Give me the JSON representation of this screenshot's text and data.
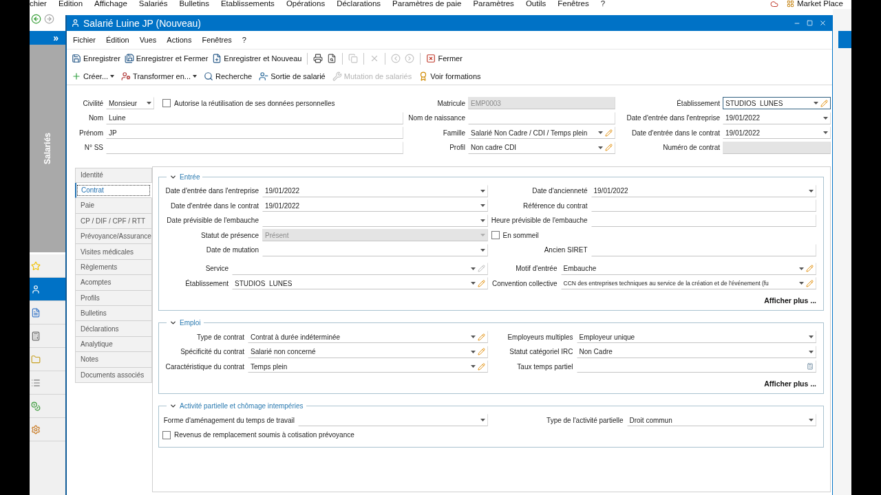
{
  "app_menu": [
    "chier",
    "Edition",
    "Affichage",
    "Salariés",
    "Bulletins",
    "Etablissements",
    "Opérations",
    "Déclarations",
    "Paramètres de paie",
    "Paramètres",
    "Outils",
    "Fenêtres",
    "?"
  ],
  "market_place": "Market Place",
  "side_panel": {
    "title": "Salariés",
    "expand": "»",
    "items": [
      {
        "selected": false
      },
      {
        "selected": true
      },
      {
        "selected": false
      },
      {
        "selected": false
      },
      {
        "selected": false
      },
      {
        "selected": false
      },
      {
        "selected": false
      },
      {
        "selected": false
      }
    ]
  },
  "window": {
    "title": "Salarié Luine JP (Nouveau)"
  },
  "menu": [
    "Fichier",
    "Édition",
    "Vues",
    "Actions",
    "Fenêtres",
    "?"
  ],
  "toolbar_1": [
    {
      "kind": "button",
      "label": "Enregistrer",
      "disabled": false
    },
    {
      "kind": "button",
      "label": "Enregistrer et Fermer",
      "disabled": false
    },
    {
      "kind": "button",
      "label": "Enregistrer et Nouveau",
      "disabled": false
    },
    {
      "kind": "separator"
    },
    {
      "kind": "button",
      "disabled": false
    },
    {
      "kind": "button",
      "disabled": false
    },
    {
      "kind": "separator"
    },
    {
      "kind": "button",
      "disabled": true
    },
    {
      "kind": "separator"
    },
    {
      "kind": "button",
      "disabled": true
    },
    {
      "kind": "separator"
    },
    {
      "kind": "button",
      "disabled": true
    },
    {
      "kind": "button",
      "disabled": true
    },
    {
      "kind": "separator"
    },
    {
      "kind": "button",
      "label": "Fermer",
      "disabled": false
    }
  ],
  "toolbar_2": [
    {
      "label": "Créer...",
      "menu": true,
      "disabled": false
    },
    {
      "label": "Transformer en...",
      "menu": true,
      "disabled": false
    },
    {
      "label": "Recherche",
      "menu": false,
      "disabled": false
    },
    {
      "label": "Sortie de salarié",
      "menu": false,
      "disabled": false
    },
    {
      "label": "Mutation de salariés",
      "menu": false,
      "disabled": true
    },
    {
      "label": "Voir formations",
      "menu": false,
      "disabled": false
    }
  ],
  "header": {
    "left": [
      {
        "label": "Civilité",
        "value": "Monsieur",
        "kind": "dropdown"
      },
      {
        "label": "Nom",
        "value": "Luine",
        "kind": "text"
      },
      {
        "label": "Prénom",
        "value": "JP",
        "kind": "text"
      },
      {
        "label": "N° SS",
        "kind": "text"
      }
    ],
    "consent": {
      "label": "Autorise la réutilisation de ses données personnelles",
      "checked": false
    },
    "middle": [
      {
        "label": "Matricule",
        "value": "EMP0003",
        "kind": "text",
        "disabled": true
      },
      {
        "label": "Nom de naissance",
        "kind": "text"
      },
      {
        "label": "Famille",
        "value": "Salarié Non Cadre / CDI / Temps plein",
        "kind": "dropdown",
        "edit": {
          "disabled": false
        }
      },
      {
        "label": "Profil",
        "value": "Non cadre CDI",
        "kind": "dropdown",
        "edit": {
          "disabled": false
        }
      }
    ],
    "right": [
      {
        "label": "Établissement",
        "value": "STUDIOS  LUNES",
        "kind": "dropdown",
        "edit": {
          "disabled": false
        },
        "focused": true
      },
      {
        "label": "Date d'entrée dans l'entreprise",
        "value": "19/01/2022",
        "kind": "dropdown"
      },
      {
        "label": "Date d'entrée dans le contrat",
        "value": "19/01/2022",
        "kind": "dropdown"
      },
      {
        "label": "Numéro de contrat",
        "kind": "text",
        "disabled": true
      }
    ]
  },
  "tabs": [
    {
      "label": "Identité",
      "selected": false
    },
    {
      "label": "Contrat",
      "selected": true
    },
    {
      "label": "Paie",
      "selected": false
    },
    {
      "label": "CP / DIF / CPF / RTT",
      "selected": false
    },
    {
      "label": "Prévoyance/Assurance",
      "selected": false
    },
    {
      "label": "Visites médicales",
      "selected": false
    },
    {
      "label": "Règlements",
      "selected": false
    },
    {
      "label": "Acomptes",
      "selected": false
    },
    {
      "label": "Profils",
      "selected": false
    },
    {
      "label": "Bulletins",
      "selected": false
    },
    {
      "label": "Déclarations",
      "selected": false
    },
    {
      "label": "Analytique",
      "selected": false
    },
    {
      "label": "Notes",
      "selected": false
    },
    {
      "label": "Documents associés",
      "selected": false
    }
  ],
  "sections": [
    {
      "title": "Entrée",
      "expanded": true,
      "more": "Afficher plus ...",
      "groups": [
        {
          "rows": [
            {
              "left": {
                "label": "Date d'entrée dans l'entreprise",
                "value": "19/01/2022",
                "kind": "dropdown"
              },
              "right": {
                "label": "Date d'ancienneté",
                "value": "19/01/2022",
                "kind": "dropdown"
              }
            },
            {
              "left": {
                "label": "Date d'entrée dans le contrat",
                "value": "19/01/2022",
                "kind": "dropdown"
              },
              "right": {
                "label": "Référence du contrat",
                "kind": "text"
              }
            },
            {
              "left": {
                "label": "Date prévisible de l'embauche",
                "kind": "dropdown"
              },
              "right": {
                "label": "Heure prévisible de l'embauche",
                "kind": "text"
              }
            },
            {
              "left": {
                "label": "Statut de présence",
                "value": "Présent",
                "kind": "dropdown",
                "disabled": true
              },
              "right": {
                "label": "En sommeil",
                "kind": "checkbox",
                "checked": false
              }
            },
            {
              "left": {
                "label": "Date de mutation",
                "kind": "dropdown"
              },
              "right": {
                "label": "Ancien SIRET",
                "kind": "text"
              }
            }
          ]
        },
        {
          "rows": [
            {
              "left": {
                "label": "Service",
                "kind": "dropdown",
                "edit": {
                  "disabled": true
                }
              },
              "right": {
                "label": "Motif d'entrée",
                "value": "Embauche",
                "kind": "dropdown",
                "edit": {
                  "disabled": false
                }
              }
            },
            {
              "left": {
                "label": "Établissement",
                "value": "STUDIOS  LUNES",
                "kind": "dropdown",
                "edit": {
                  "disabled": false
                }
              },
              "right": {
                "label": "Convention collective",
                "value": "CCN des entreprises techniques au service de la création et de l'événement (fu",
                "kind": "dropdown",
                "edit": {
                  "disabled": false
                }
              }
            }
          ]
        }
      ]
    },
    {
      "title": "Emploi",
      "expanded": true,
      "more": "Afficher plus ...",
      "groups": [
        {
          "rows": [
            {
              "left": {
                "label": "Type de contrat",
                "value": "Contrat à durée indéterminée",
                "kind": "dropdown",
                "edit": {
                  "disabled": false
                }
              },
              "right": {
                "label": "Employeurs multiples",
                "value": "Employeur unique",
                "kind": "dropdown"
              }
            },
            {
              "left": {
                "label": "Spécificité du contrat",
                "value": "Salarié non concerné",
                "kind": "dropdown",
                "edit": {
                  "disabled": false
                }
              },
              "right": {
                "label": "Statut catégoriel IRC",
                "value": "Non Cadre",
                "kind": "dropdown"
              }
            },
            {
              "left": {
                "label": "Caractéristique du contrat",
                "value": "Temps plein",
                "kind": "dropdown",
                "edit": {
                  "disabled": false
                }
              },
              "right": {
                "label": "Taux temps partiel",
                "kind": "calc"
              }
            }
          ]
        }
      ]
    },
    {
      "title": "Activité partielle et chômage intempéries",
      "expanded": true,
      "groups": [
        {
          "rows": [
            {
              "left": {
                "label": "Forme d'aménagement du temps de travail",
                "kind": "dropdown"
              },
              "right": {
                "label": "Type de l'activité partielle",
                "value": "Droit commun",
                "kind": "dropdown"
              }
            },
            {
              "left": {
                "label": "Revenus de remplacement soumis à cotisation prévoyance",
                "kind": "checkbox",
                "checked": false
              }
            }
          ]
        }
      ]
    }
  ]
}
